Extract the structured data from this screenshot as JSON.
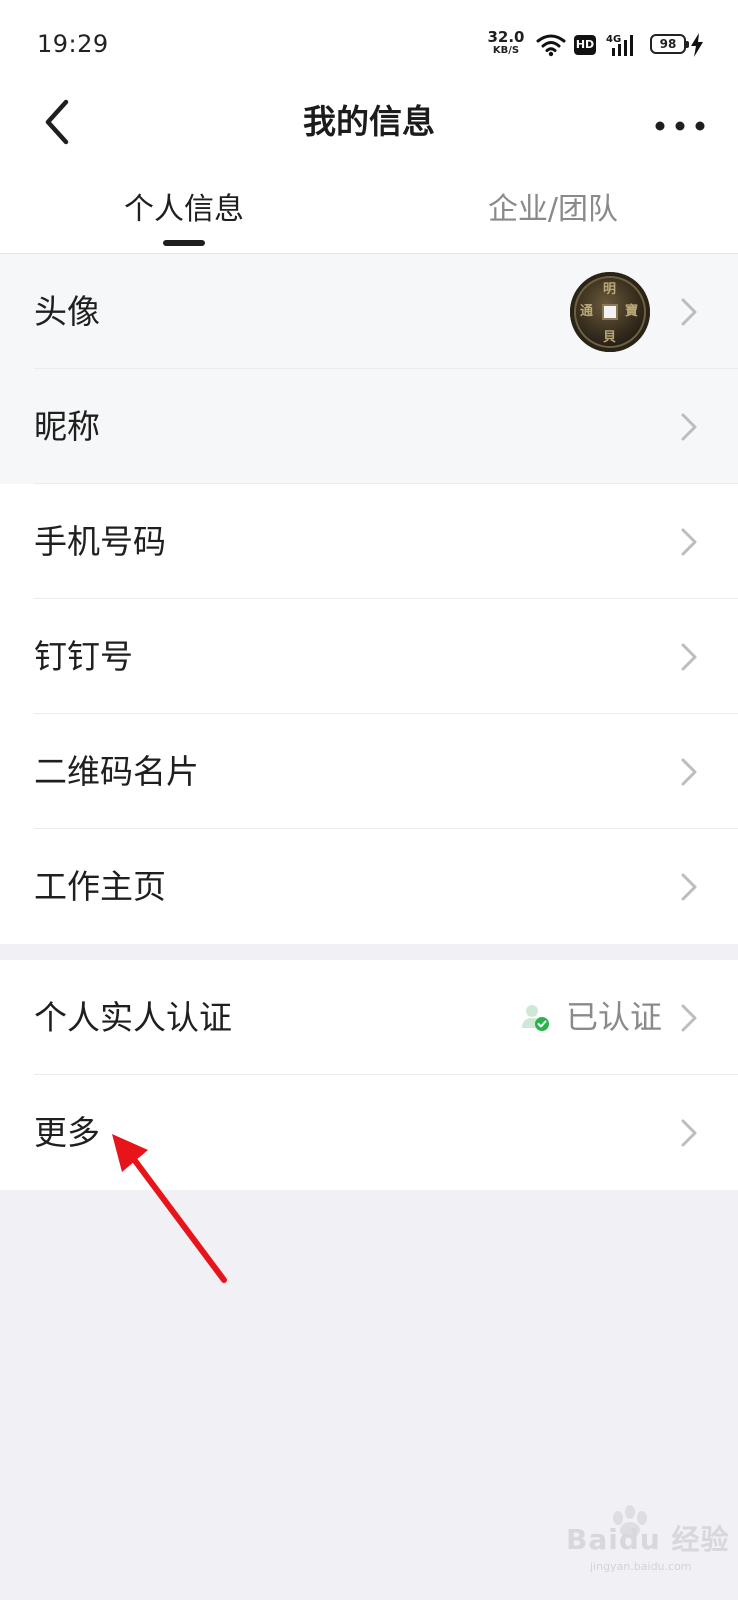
{
  "status_bar": {
    "time": "19:29",
    "net_speed_value": "32.0",
    "net_speed_unit": "KB/S",
    "hd_label": "HD",
    "signal_label": "4G",
    "battery_level": "98"
  },
  "header": {
    "title": "我的信息"
  },
  "tabs": [
    {
      "label": "个人信息",
      "active": true
    },
    {
      "label": "企业/团队",
      "active": false
    }
  ],
  "avatar": {
    "glyphs": [
      "明",
      "寶",
      "貝",
      "通"
    ]
  },
  "list": [
    {
      "label": "头像"
    },
    {
      "label": "昵称"
    },
    {
      "label": "手机号码"
    },
    {
      "label": "钉钉号"
    },
    {
      "label": "二维码名片"
    },
    {
      "label": "工作主页"
    }
  ],
  "list2": [
    {
      "label": "个人实人认证",
      "status": "已认证"
    },
    {
      "label": "更多"
    }
  ],
  "watermark": {
    "brand": "Baidu 经验",
    "url": "jingyan.baidu.com"
  },
  "colors": {
    "verified_green": "#2bb24c",
    "annotation_red": "#e8141b"
  }
}
